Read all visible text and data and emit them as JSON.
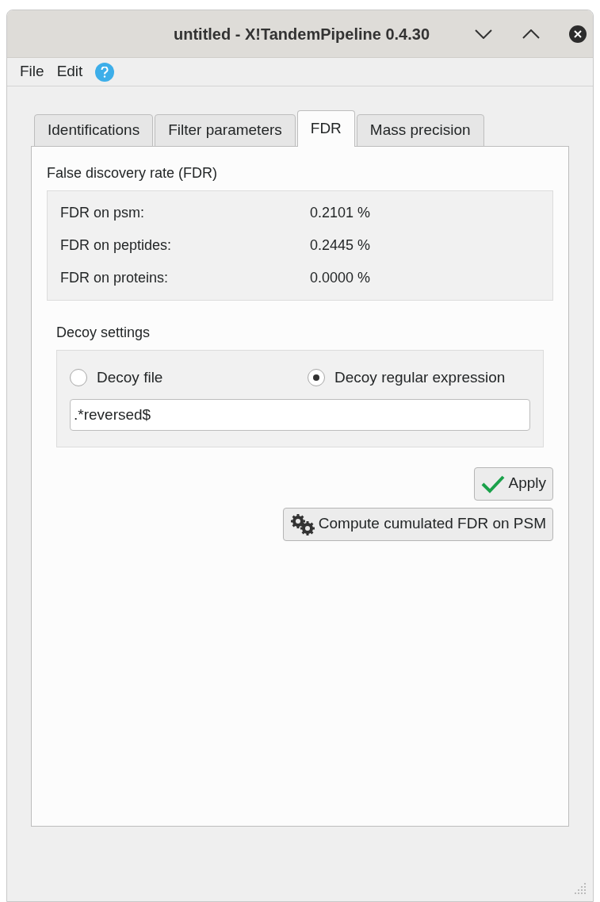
{
  "window": {
    "title": "untitled - X!TandemPipeline 0.4.30"
  },
  "menu": [
    {
      "label": "File"
    },
    {
      "label": "Edit"
    }
  ],
  "tabs": [
    {
      "label": "Identifications",
      "selected": false
    },
    {
      "label": "Filter parameters",
      "selected": false
    },
    {
      "label": "FDR",
      "selected": true
    },
    {
      "label": "Mass precision",
      "selected": false
    }
  ],
  "fdr": {
    "title": "False discovery rate (FDR)",
    "rows": [
      {
        "label": "FDR on psm:",
        "value": "0.2101 %"
      },
      {
        "label": "FDR on peptides:",
        "value": "0.2445 %"
      },
      {
        "label": "FDR on proteins:",
        "value": "0.0000 %"
      }
    ]
  },
  "decoy": {
    "title": "Decoy settings",
    "options": [
      {
        "label": "Decoy file",
        "selected": false
      },
      {
        "label": "Decoy regular expression",
        "selected": true
      }
    ],
    "value": ".*reversed$"
  },
  "buttons": [
    {
      "kind": "apply",
      "label": "Apply"
    },
    {
      "kind": "compute",
      "label": "Compute cumulated FDR on PSM"
    }
  ]
}
